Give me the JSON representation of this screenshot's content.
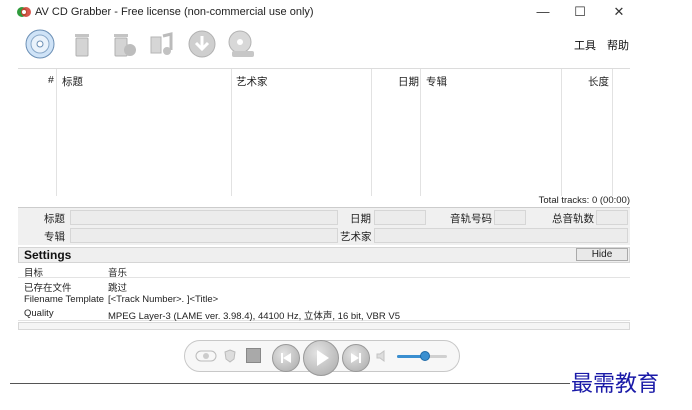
{
  "window": {
    "title": "AV CD Grabber - Free license (non-commercial use only)",
    "controls": {
      "minimize": "—",
      "maximize": "☐",
      "close": "✕"
    }
  },
  "toolbar": {
    "icons": [
      "cd-icon",
      "trash-icon",
      "trash-all-icon",
      "music-note-icon",
      "download-icon",
      "cd-settings-icon"
    ],
    "menu": {
      "tools": "工具",
      "help": "帮助"
    }
  },
  "track_table": {
    "columns": [
      "#",
      "标题",
      "艺术家",
      "日期",
      "专辑",
      "长度"
    ],
    "rows": [],
    "total": "Total tracks: 0 (00:00)"
  },
  "info": {
    "title_label": "标题",
    "date_label": "日期",
    "track_no_label": "音轨号码",
    "total_tracks_label": "总音轨数",
    "album_label": "专辑",
    "artist_label": "艺术家"
  },
  "settings": {
    "title": "Settings",
    "hide_label": "Hide",
    "rows": [
      {
        "key": "目标",
        "value": "音乐"
      },
      {
        "key": "已存在文件",
        "value": "跳过"
      },
      {
        "key": "Filename Template",
        "value": "[<Track Number>. ]<Title>"
      },
      {
        "key": "Quality",
        "value": "MPEG Layer-3 (LAME ver. 3.98.4), 44100 Hz, 立体声, 16 bit, VBR V5"
      }
    ]
  },
  "player": {
    "volume": 0.55
  },
  "watermark": "最需教育",
  "colors": {
    "accent": "#3a8fd0",
    "watermark": "#1a1aa8"
  }
}
